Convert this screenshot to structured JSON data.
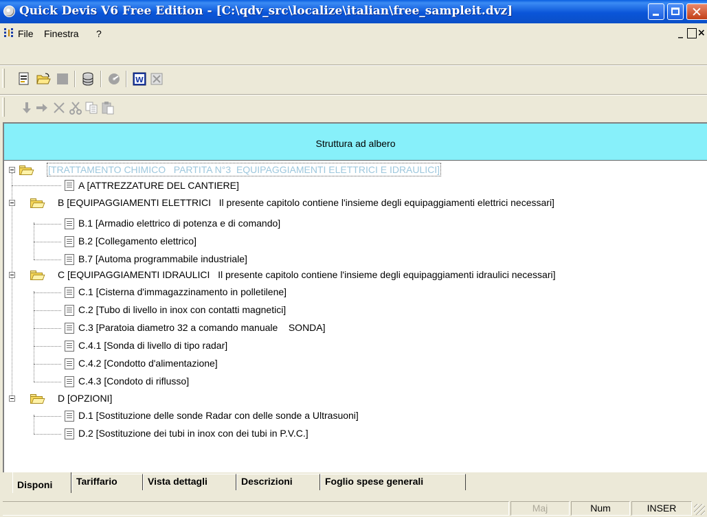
{
  "window": {
    "title": "Quick Devis V6 Free Edition - [C:\\qdv_src\\localize\\italian\\free_sampleit.dvz]",
    "close_glyph": "✕"
  },
  "menu": {
    "items": [
      "File",
      "Finestra",
      "?"
    ],
    "mdi_controls": [
      "_",
      "ð",
      "×"
    ]
  },
  "toolbar1": {
    "icons": [
      "new-document-icon",
      "open-folder-icon",
      "save-icon",
      "database-icon",
      "disc-icon",
      "word-export-icon",
      "excel-export-icon"
    ]
  },
  "toolbar2": {
    "icons": [
      "move-down-icon",
      "move-right-icon",
      "delete-icon",
      "cut-icon",
      "copy-icon",
      "paste-icon"
    ]
  },
  "panel": {
    "header": "Struttura ad albero"
  },
  "tree": {
    "root": "[TRATTAMENTO CHIMICO   PARTITA N°3  EQUIPAGGIAMENTI ELETTRICI E IDRAULICI]",
    "a": "A [ATTREZZATURE DEL CANTIERE]",
    "b": "B [EQUIPAGGIAMENTI ELETTRICI   Il presente capitolo contiene l'insieme degli equipaggiamenti elettrici necessari]",
    "b1": "B.1 [Armadio elettrico di potenza e di comando]",
    "b2": "B.2 [Collegamento elettrico]",
    "b7": "B.7 [Automa programmabile industriale]",
    "c": "C [EQUIPAGGIAMENTI IDRAULICI   Il presente capitolo contiene l'insieme degli equipaggiamenti idraulici necessari]",
    "c1": "C.1 [Cisterna d'immagazzinamento in polletilene]",
    "c2": "C.2 [Tubo di livello in inox con contatti magnetici]",
    "c3": "C.3 [Paratoia diametro 32 a comando manuale    SONDA]",
    "c41": "C.4.1 [Sonda di livello di tipo radar]",
    "c42": "C.4.2 [Condotto d'alimentazione]",
    "c43": "C.4.3 [Condoto di riflusso]",
    "d": "D [OPZIONI]",
    "d1": "D.1 [Sostituzione delle sonde Radar con delle sonde a Ultrasuoni]",
    "d2": "D.2 [Sostituzione dei tubi in inox con dei tubi in P.V.C.]"
  },
  "tabs": [
    "Disponi",
    "Tariffario",
    "Vista dettagli",
    "Descrizioni",
    "Foglio spese generali"
  ],
  "status": {
    "maj": "Maj",
    "num": "Num",
    "inser": "INSER"
  }
}
